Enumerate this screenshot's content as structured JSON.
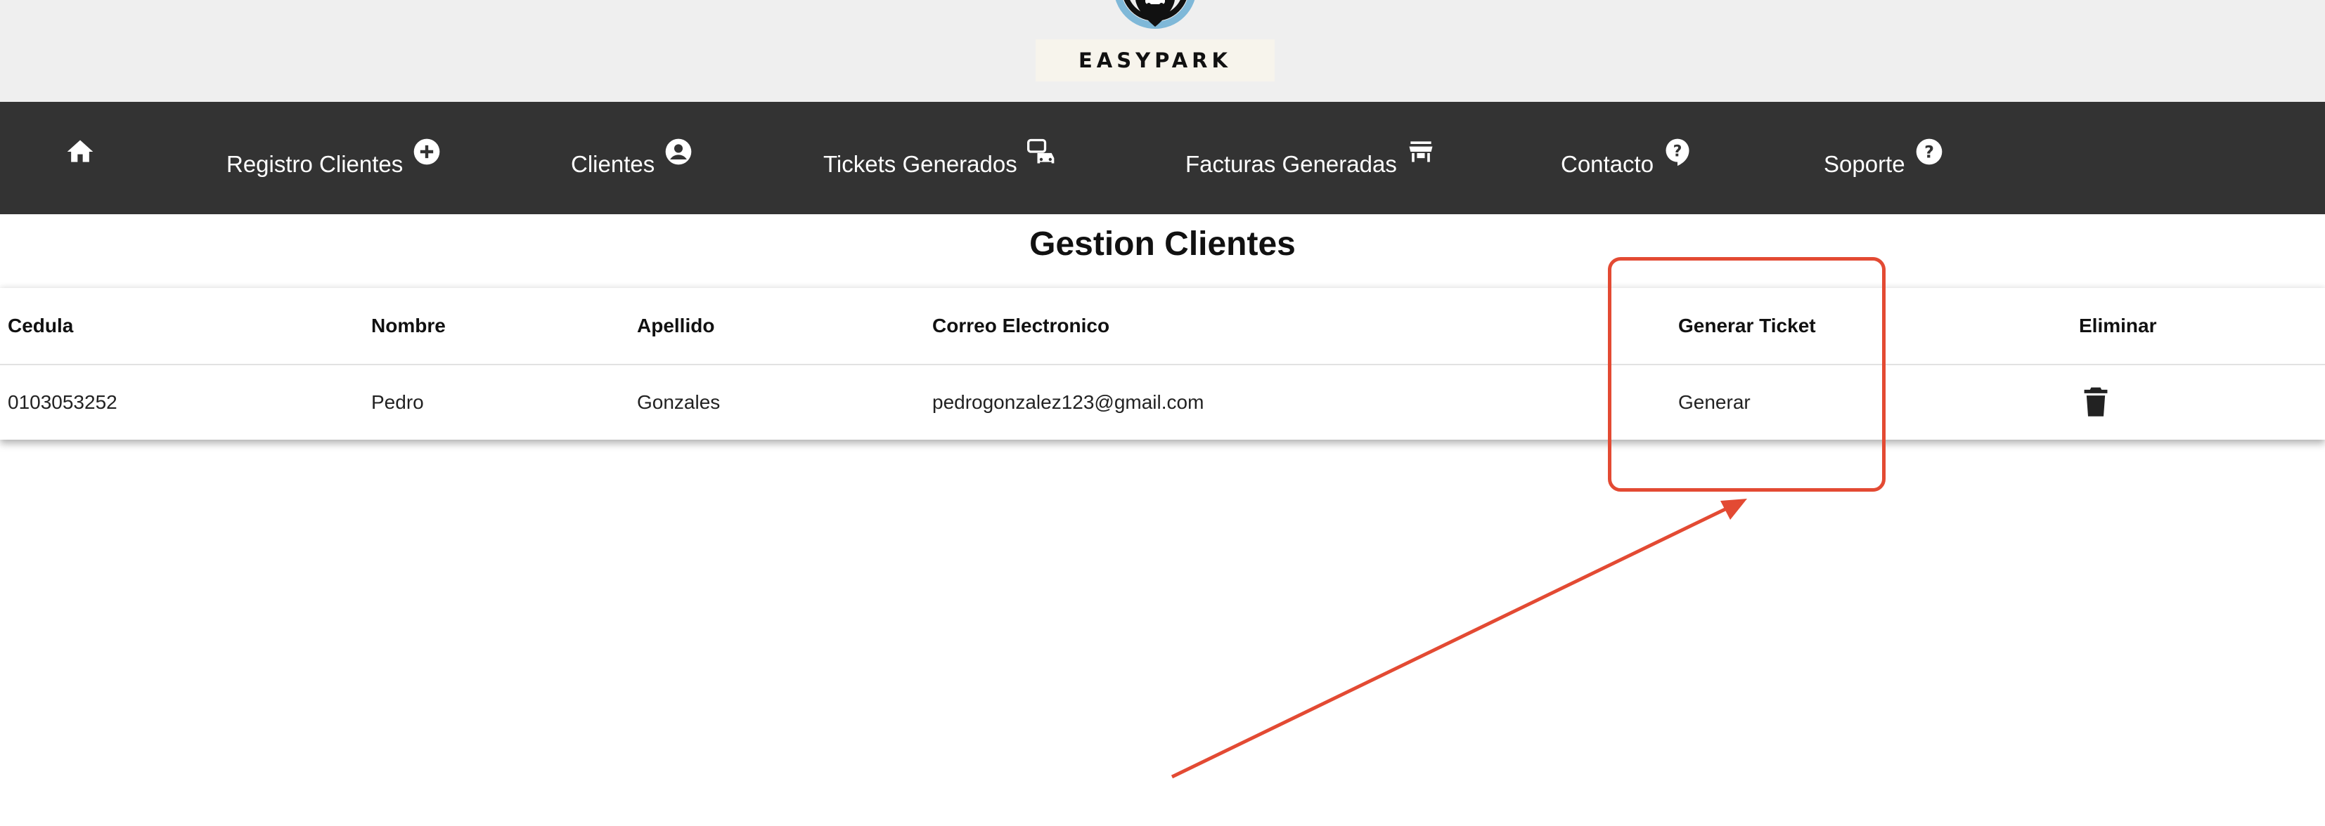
{
  "brand": {
    "logo_text": "EASYPARK"
  },
  "navbar": {
    "items": [
      {
        "label": "",
        "icon": "home-icon"
      },
      {
        "label": "Registro Clientes",
        "icon": "add-circle-icon"
      },
      {
        "label": "Clientes",
        "icon": "account-circle-icon"
      },
      {
        "label": "Tickets Generados",
        "icon": "car-ticket-icon"
      },
      {
        "label": "Facturas Generadas",
        "icon": "store-icon"
      },
      {
        "label": "Contacto",
        "icon": "help-bubble-icon"
      },
      {
        "label": "Soporte",
        "icon": "help-circle-icon"
      }
    ]
  },
  "main": {
    "title": "Gestion Clientes",
    "table": {
      "headers": [
        "Cedula",
        "Nombre",
        "Apellido",
        "Correo Electronico",
        "Generar Ticket",
        "Eliminar"
      ],
      "rows": [
        {
          "cedula": "0103053252",
          "nombre": "Pedro",
          "apellido": "Gonzales",
          "correo": "pedrogonzalez123@gmail.com",
          "generar": "Generar",
          "eliminar_icon": "trash-icon"
        }
      ]
    }
  },
  "colors": {
    "navbar_bg": "#333333",
    "header_bg": "#efefef",
    "annotation": "#e34a33"
  }
}
